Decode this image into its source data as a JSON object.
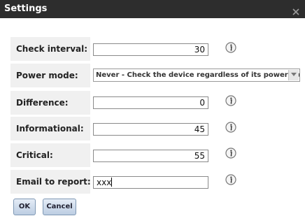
{
  "title": "Settings",
  "fields": {
    "check_interval": {
      "label": "Check interval:",
      "value": "30"
    },
    "power_mode": {
      "label": "Power mode:",
      "value": "Never - Check the device regardless of its power mode"
    },
    "difference": {
      "label": "Difference:",
      "value": "0"
    },
    "informational": {
      "label": "Informational:",
      "value": "45"
    },
    "critical": {
      "label": "Critical:",
      "value": "55"
    },
    "email": {
      "label": "Email to report:",
      "value": "xxx"
    }
  },
  "buttons": {
    "ok": "OK",
    "cancel": "Cancel"
  },
  "icons": {
    "close": "close-icon",
    "info": "info-icon",
    "dropdown": "chevron-down-icon"
  }
}
